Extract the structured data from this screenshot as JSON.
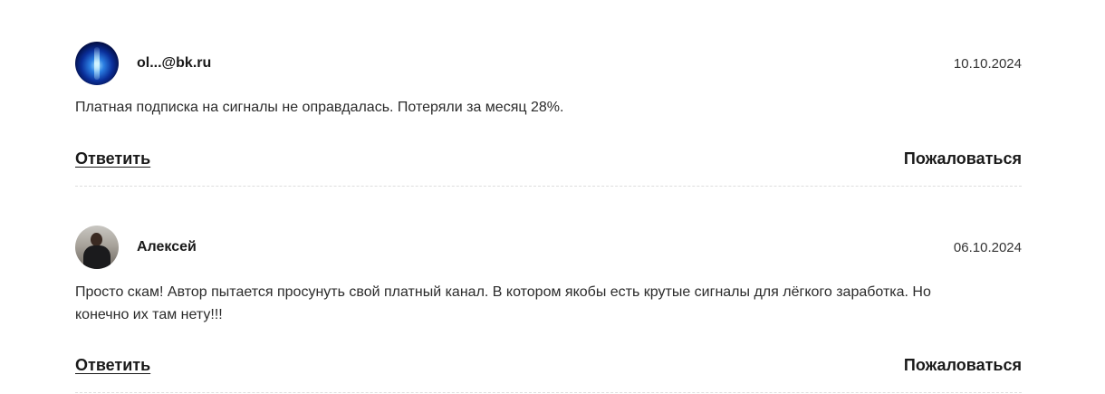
{
  "comments": [
    {
      "author": "ol...@bk.ru",
      "date": "10.10.2024",
      "text": "Платная подписка на сигналы не оправдалась. Потеряли за месяц 28%.",
      "reply_label": "Ответить",
      "report_label": "Пожаловаться",
      "avatar_icon": "abstract-blue-avatar"
    },
    {
      "author": "Алексей",
      "date": "06.10.2024",
      "text": "Просто скам! Автор пытается просунуть свой платный канал. В котором якобы есть крутые сигналы для лёгкого заработка. Но конечно их там нету!!!",
      "reply_label": "Ответить",
      "report_label": "Пожаловаться",
      "avatar_icon": "person-photo-avatar"
    }
  ]
}
